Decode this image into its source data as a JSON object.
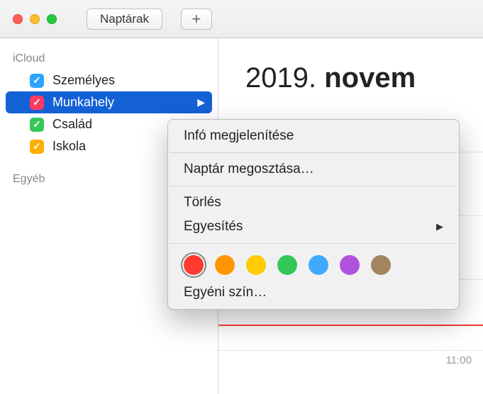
{
  "toolbar": {
    "calendars_btn": "Naptárak",
    "add_icon": "+"
  },
  "sidebar": {
    "sections": [
      {
        "title": "iCloud"
      },
      {
        "title": "Egyéb"
      }
    ],
    "calendars": [
      {
        "label": "Személyes",
        "color": "#2da3ff",
        "selected": false
      },
      {
        "label": "Munkahely",
        "color": "#ff3b62",
        "selected": true
      },
      {
        "label": "Család",
        "color": "#34c759",
        "selected": false
      },
      {
        "label": "Iskola",
        "color": "#ffae00",
        "selected": false
      }
    ]
  },
  "main": {
    "date_year": "2019. ",
    "date_rest": "novem",
    "time_label": "11:00"
  },
  "context_menu": {
    "items": [
      {
        "label": "Infó megjelenítése"
      },
      {
        "label": "Naptár megosztása…"
      },
      {
        "label": "Törlés"
      },
      {
        "label": "Egyesítés",
        "submenu": true
      },
      {
        "label": "Egyéni szín…"
      }
    ],
    "colors": [
      {
        "hex": "#ff3b30",
        "selected": true
      },
      {
        "hex": "#ff9500",
        "selected": false
      },
      {
        "hex": "#ffcc00",
        "selected": false
      },
      {
        "hex": "#34c759",
        "selected": false
      },
      {
        "hex": "#41aaff",
        "selected": false
      },
      {
        "hex": "#af52de",
        "selected": false
      },
      {
        "hex": "#a2845e",
        "selected": false
      }
    ]
  }
}
